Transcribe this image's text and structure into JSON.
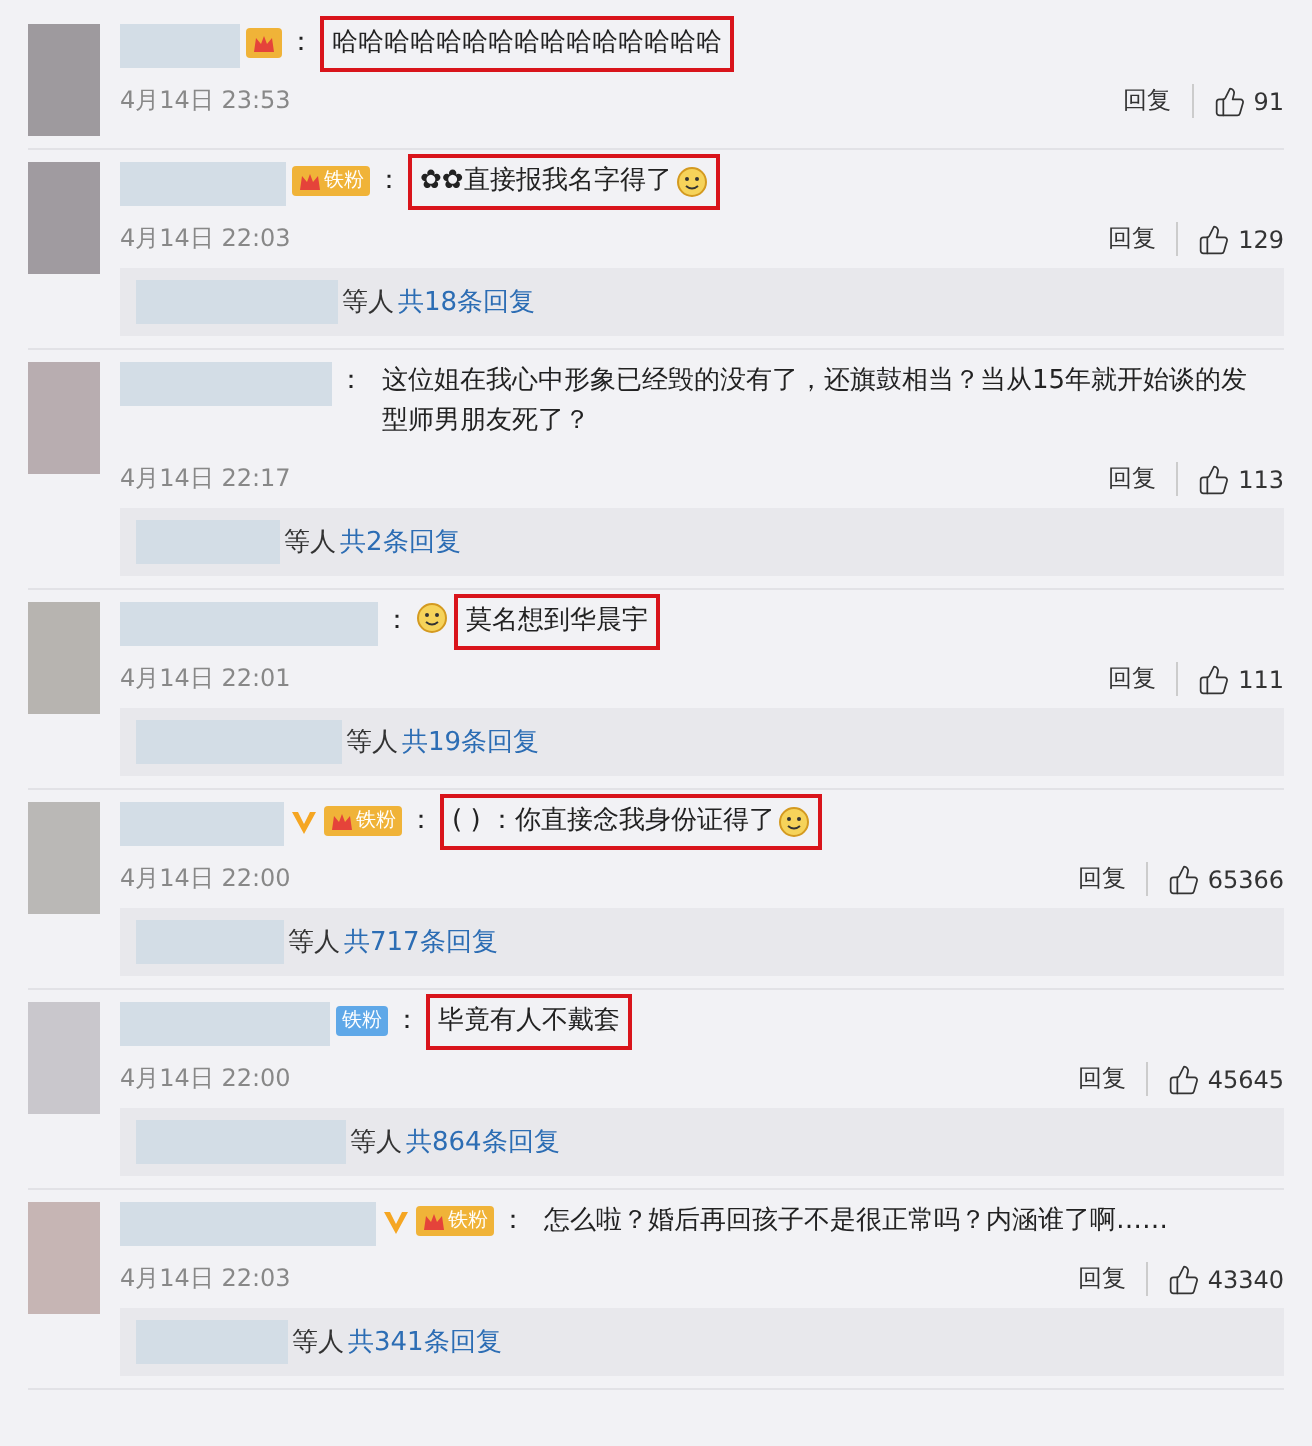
{
  "comments": [
    {
      "badges": [
        {
          "kind": "crown"
        }
      ],
      "colon": "：",
      "content": "哈哈哈哈哈哈哈哈哈哈哈哈哈哈哈",
      "highlighted": true,
      "time": "4月14日 23:53",
      "reply": "回复",
      "likes": "91"
    },
    {
      "badges": [
        {
          "kind": "crown",
          "label": "铁粉"
        }
      ],
      "colon": "：",
      "content": "✿✿直接报我名字得了",
      "highlighted": true,
      "emoji_after": true,
      "time": "4月14日 22:03",
      "reply": "回复",
      "likes": "129",
      "replies": {
        "suffix": "等人",
        "link": "共18条回复"
      }
    },
    {
      "colon": "：",
      "content": "这位姐在我心中形象已经毁的没有了，还旗鼓相当？当从15年就开始谈的发型师男朋友死了？",
      "highlighted": false,
      "time": "4月14日 22:17",
      "reply": "回复",
      "likes": "113",
      "replies": {
        "suffix": "等人",
        "link": "共2条回复"
      }
    },
    {
      "colon": "：",
      "content": "莫名想到华晨宇",
      "highlighted": true,
      "emoji_before": true,
      "time": "4月14日 22:01",
      "reply": "回复",
      "likes": "111",
      "replies": {
        "suffix": "等人",
        "link": "共19条回复"
      }
    },
    {
      "badges": [
        {
          "kind": "v"
        },
        {
          "kind": "crown",
          "label": "铁粉"
        }
      ],
      "colon": "：",
      "content": "( ) ：你直接念我身份证得了",
      "highlighted": true,
      "emoji_after": true,
      "time": "4月14日 22:00",
      "reply": "回复",
      "likes": "65366",
      "replies": {
        "suffix": "等人",
        "link": "共717条回复"
      }
    },
    {
      "badges": [
        {
          "kind": "fan",
          "label": "铁粉"
        }
      ],
      "colon": "：",
      "content": "毕竟有人不戴套",
      "highlighted": true,
      "time": "4月14日 22:00",
      "reply": "回复",
      "likes": "45645",
      "replies": {
        "suffix": "等人",
        "link": "共864条回复"
      }
    },
    {
      "badges": [
        {
          "kind": "v"
        },
        {
          "kind": "crown",
          "label": "铁粉"
        }
      ],
      "colon": "：",
      "content": "怎么啦？婚后再回孩子不是很正常吗？内涵谁了啊……",
      "highlighted": false,
      "time": "4月14日 22:03",
      "reply": "回复",
      "likes": "43340",
      "replies": {
        "suffix": "等人",
        "link": "共341条回复"
      }
    }
  ]
}
